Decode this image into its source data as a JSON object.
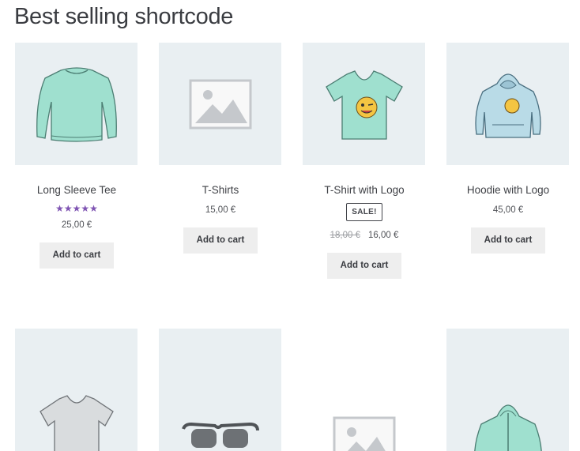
{
  "page": {
    "title": "Best selling shortcode"
  },
  "products": [
    {
      "name": "Long Sleeve Tee",
      "rating_stars": "★★★★★",
      "rating_value": 5,
      "price": "25,00 €",
      "cart_label": "Add to cart",
      "image": "long-sleeve-tee-image"
    },
    {
      "name": "T-Shirts",
      "price": "15,00 €",
      "cart_label": "Add to cart",
      "image": "placeholder-image"
    },
    {
      "name": "T-Shirt with Logo",
      "sale_label": "SALE!",
      "old_price": "18,00 €",
      "price": "16,00 €",
      "cart_label": "Add to cart",
      "image": "tshirt-logo-image"
    },
    {
      "name": "Hoodie with Logo",
      "price": "45,00 €",
      "cart_label": "Add to cart",
      "image": "hoodie-logo-image"
    },
    {
      "image": "tshirt-grey-image"
    },
    {
      "image": "sunglasses-image"
    },
    {
      "image": "placeholder-image"
    },
    {
      "image": "hoodie-zip-image"
    }
  ],
  "colors": {
    "accent_star": "#7f54b3",
    "button_bg": "#eeeeee",
    "thumb_bg": "#e9eff2",
    "mint": "#9fe0cf",
    "hoodie_blue": "#b9dbe7"
  }
}
